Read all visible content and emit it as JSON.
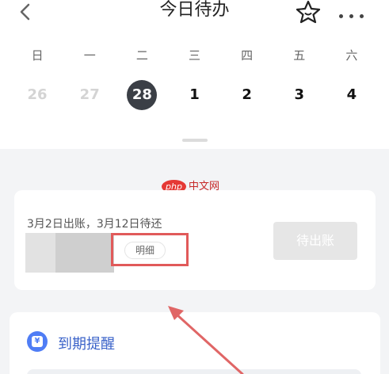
{
  "header": {
    "title": "今日待办",
    "back_icon": "back-chevron-icon",
    "star_icon": "star-icon",
    "more_icon": "more-dots-icon"
  },
  "calendar": {
    "weekdays": [
      "日",
      "一",
      "二",
      "三",
      "四",
      "五",
      "六"
    ],
    "days": [
      "26",
      "27",
      "28",
      "1",
      "2",
      "3",
      "4"
    ],
    "selected_day": "28"
  },
  "bill_card": {
    "bill_text": "3月2日出账，3月12日待还",
    "detail_label": "明细",
    "pending_button": "待出账",
    "highlight_color": "#e15a5a"
  },
  "due_card": {
    "label": "到期提醒",
    "accent_color": "#4f7df5"
  },
  "watermark": {
    "logo": "php",
    "text": "中文网"
  }
}
